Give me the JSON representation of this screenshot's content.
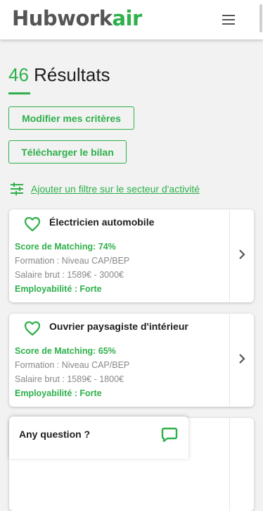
{
  "header": {
    "logo_part1": "Hubwork",
    "logo_part2": "air",
    "menu_icon": "hamburger-menu-icon",
    "brand_color": "#2eb04b"
  },
  "results": {
    "count": "46",
    "label": "Résultats"
  },
  "buttons": {
    "modify": "Modifier mes critères",
    "download": "Télécharger le bilan"
  },
  "filter": {
    "icon": "sliders-icon",
    "label": "Ajouter un filtre sur le secteur d'activité"
  },
  "jobs": [
    {
      "title": "Électricien automobile",
      "score": "Score de Matching: 74%",
      "formation": "Formation : Niveau CAP/BEP",
      "salary": "Salaire brut : 1589€ - 3000€",
      "employability": "Employabilité : Forte"
    },
    {
      "title": "Ouvrier paysagiste d'intérieur",
      "score": "Score de Matching: 65%",
      "formation": "Formation : Niveau CAP/BEP",
      "salary": "Salaire brut : 1589€ - 1800€",
      "employability": "Employabilité : Forte"
    }
  ],
  "chat": {
    "question": "Any question ?",
    "icon": "chat-bubble-icon"
  }
}
